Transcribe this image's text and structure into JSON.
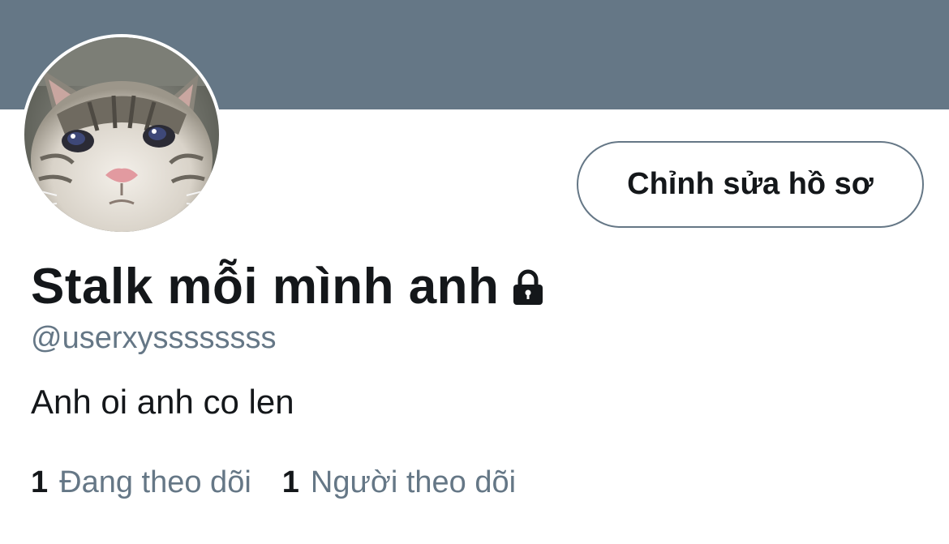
{
  "header": {
    "banner_color": "#657786"
  },
  "profile": {
    "avatar": "crying-cat-photo",
    "display_name": "Stalk mỗi mình anh",
    "protected_icon": "lock-icon",
    "handle": "@userxyssssssss",
    "bio": "Anh oi anh co len",
    "edit_button_label": "Chỉnh sửa hồ sơ"
  },
  "stats": {
    "following_count": "1",
    "following_label": "Đang theo dõi",
    "followers_count": "1",
    "followers_label": "Người theo dõi"
  },
  "colors": {
    "text_primary": "#14171a",
    "text_secondary": "#657786"
  }
}
